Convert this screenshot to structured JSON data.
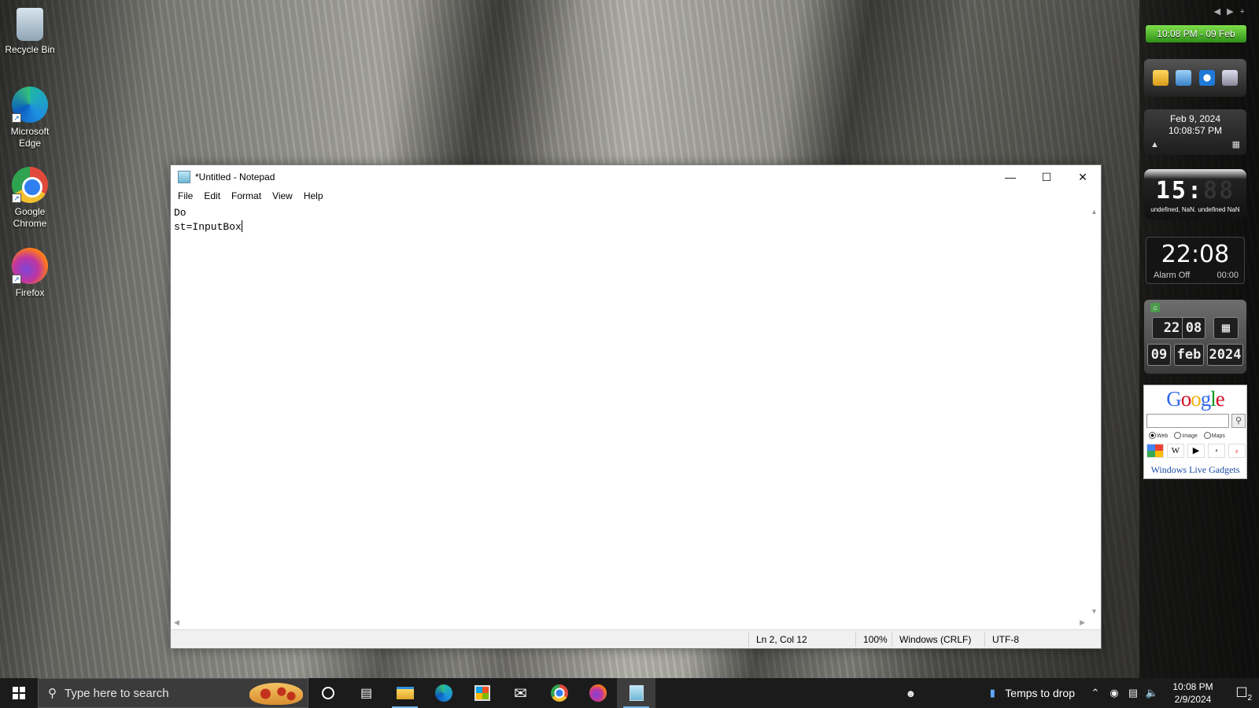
{
  "desktop": {
    "icons": [
      {
        "label": "Recycle Bin",
        "icon": "recycle-bin-icon"
      },
      {
        "label": "Microsoft Edge",
        "icon": "edge-icon"
      },
      {
        "label": "Google Chrome",
        "icon": "chrome-icon"
      },
      {
        "label": "Firefox",
        "icon": "firefox-icon"
      }
    ]
  },
  "notepad": {
    "title": "*Untitled - Notepad",
    "menu": [
      "File",
      "Edit",
      "Format",
      "View",
      "Help"
    ],
    "lines": [
      "Do",
      "st=InputBox"
    ],
    "status": {
      "position": "Ln 2, Col 12",
      "zoom": "100%",
      "line_ending": "Windows (CRLF)",
      "encoding": "UTF-8"
    }
  },
  "gadgets": {
    "green_clock": "10:08 PM - 09 Feb",
    "date_gadget": {
      "date": "Feb 9, 2024",
      "time": "10:08:57 PM"
    },
    "digital_clock": {
      "digits": "15:",
      "dim_digits": "88",
      "subtitle": "undefined, NaN. undefined NaN"
    },
    "alarm_clock": {
      "time": "22:08",
      "alarm": "Alarm Off",
      "alarm_time": "00:00"
    },
    "flip_clock": {
      "hour": "22",
      "minute": "08",
      "day": "09",
      "month": "feb",
      "year": "2024"
    },
    "google": {
      "logo_letters": [
        "G",
        "o",
        "o",
        "g",
        "l",
        "e"
      ],
      "logo_colors": [
        "#3369e8",
        "#d50f25",
        "#eeb211",
        "#3369e8",
        "#009925",
        "#d50f25"
      ],
      "radio_options": [
        "Web",
        "Image",
        "Maps"
      ],
      "footer_link": "Windows Live Gadgets"
    }
  },
  "taskbar": {
    "search_placeholder": "Type here to search",
    "apps": [
      "cortana-icon",
      "task-view-icon",
      "file-explorer-icon",
      "edge-icon",
      "store-icon",
      "mail-icon",
      "chrome-icon",
      "firefox-icon",
      "notepad-icon"
    ],
    "weather": "Temps to drop",
    "clock_time": "10:08 PM",
    "clock_date": "2/9/2024",
    "notification_count": "2"
  }
}
